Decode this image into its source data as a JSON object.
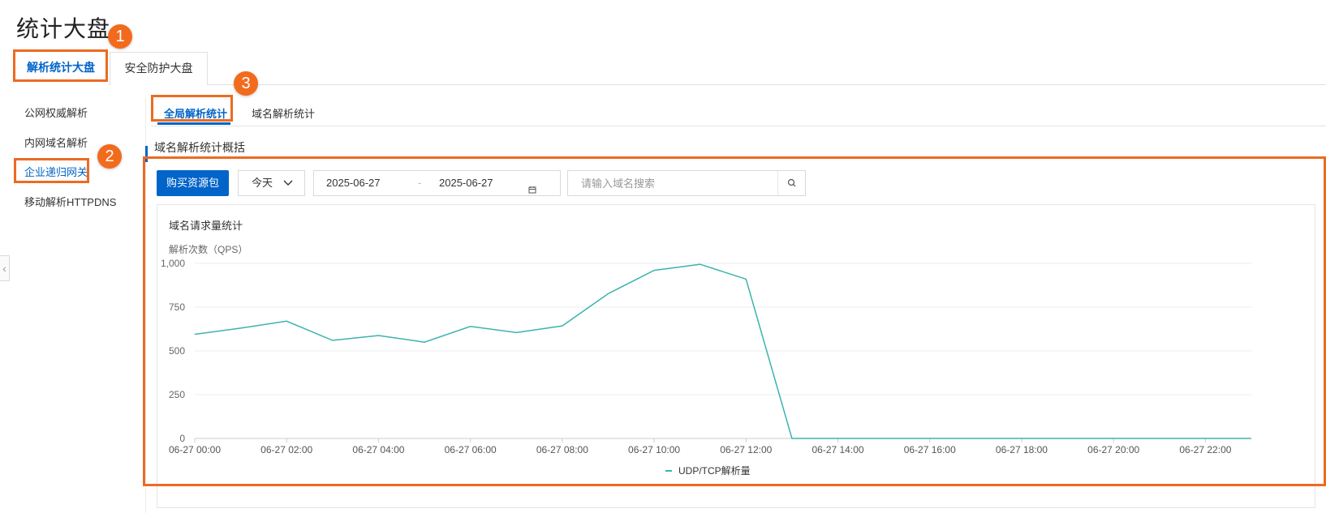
{
  "page": {
    "title": "统计大盘"
  },
  "badges": [
    "1",
    "2",
    "3"
  ],
  "top_tabs": [
    {
      "label": "解析统计大盘",
      "active": true
    },
    {
      "label": "安全防护大盘",
      "active": false
    }
  ],
  "sidebar": {
    "items": [
      {
        "label": "公网权威解析",
        "active": false
      },
      {
        "label": "内网域名解析",
        "active": false
      },
      {
        "label": "企业递归网关",
        "active": true
      },
      {
        "label": "移动解析HTTPDNS",
        "active": false
      }
    ]
  },
  "sub_tabs": [
    {
      "label": "全局解析统计",
      "active": true
    },
    {
      "label": "域名解析统计",
      "active": false
    }
  ],
  "section": {
    "title": "域名解析统计概括"
  },
  "toolbar": {
    "buy_label": "购买资源包",
    "period_selected": "今天",
    "date_start": "2025-06-27",
    "date_separator": "-",
    "date_end": "2025-06-27",
    "search_placeholder": "请输入域名搜索"
  },
  "icons": {
    "calendar": "calendar-icon",
    "search": "search-icon",
    "chevron": "chevron-down-icon",
    "collapse": "chevron-left-icon"
  },
  "colors": {
    "primary": "#0064c8",
    "highlight": "#ec6b22",
    "series": "#3bb3ae"
  },
  "chart_data": {
    "type": "line",
    "title": "域名请求量统计",
    "ylabel": "解析次数（QPS）",
    "ylim": [
      0,
      1000
    ],
    "yticks": [
      0,
      250,
      500,
      750,
      1000
    ],
    "ytick_labels": [
      "0",
      "250",
      "500",
      "750",
      "1,000"
    ],
    "xtick_labels": [
      "06-27 00:00",
      "06-27 02:00",
      "06-27 04:00",
      "06-27 06:00",
      "06-27 08:00",
      "06-27 10:00",
      "06-27 12:00",
      "06-27 14:00",
      "06-27 16:00",
      "06-27 18:00",
      "06-27 20:00",
      "06-27 22:00"
    ],
    "x_hours": [
      0,
      1,
      2,
      3,
      4,
      5,
      6,
      7,
      8,
      9,
      10,
      11,
      12,
      13,
      14,
      15,
      16,
      17,
      18,
      19,
      20,
      21,
      22,
      23
    ],
    "grid": true,
    "legend_position": "bottom-center",
    "series": [
      {
        "name": "UDP/TCP解析量",
        "values": [
          595,
          630,
          670,
          560,
          588,
          550,
          640,
          605,
          643,
          827,
          960,
          995,
          910,
          0,
          0,
          0,
          0,
          0,
          0,
          0,
          0,
          0,
          0,
          0
        ]
      }
    ]
  }
}
